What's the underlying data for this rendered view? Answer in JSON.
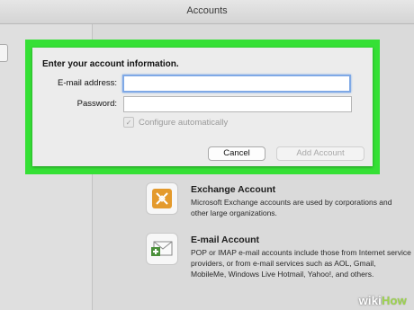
{
  "window": {
    "title": "Accounts"
  },
  "accounts": [
    {
      "icon": "exchange-icon",
      "name": "Exchange Account",
      "description": "Microsoft Exchange accounts are used by corporations and other large organizations."
    },
    {
      "icon": "email-account-icon",
      "name": "E-mail Account",
      "description": "POP or IMAP e-mail accounts include those from Internet service providers, or from e-mail services such as AOL, Gmail, MobileMe, Windows Live Hotmail, Yahoo!, and others."
    }
  ],
  "dialog": {
    "heading": "Enter your account information.",
    "email_label": "E-mail address:",
    "email_value": "",
    "password_label": "Password:",
    "password_value": "",
    "configure_label": "Configure automatically",
    "configure_checked": true,
    "cancel_label": "Cancel",
    "add_label": "Add Account",
    "highlight_color": "#35e035"
  },
  "watermark": {
    "part1": "wiki",
    "part2": "How"
  }
}
